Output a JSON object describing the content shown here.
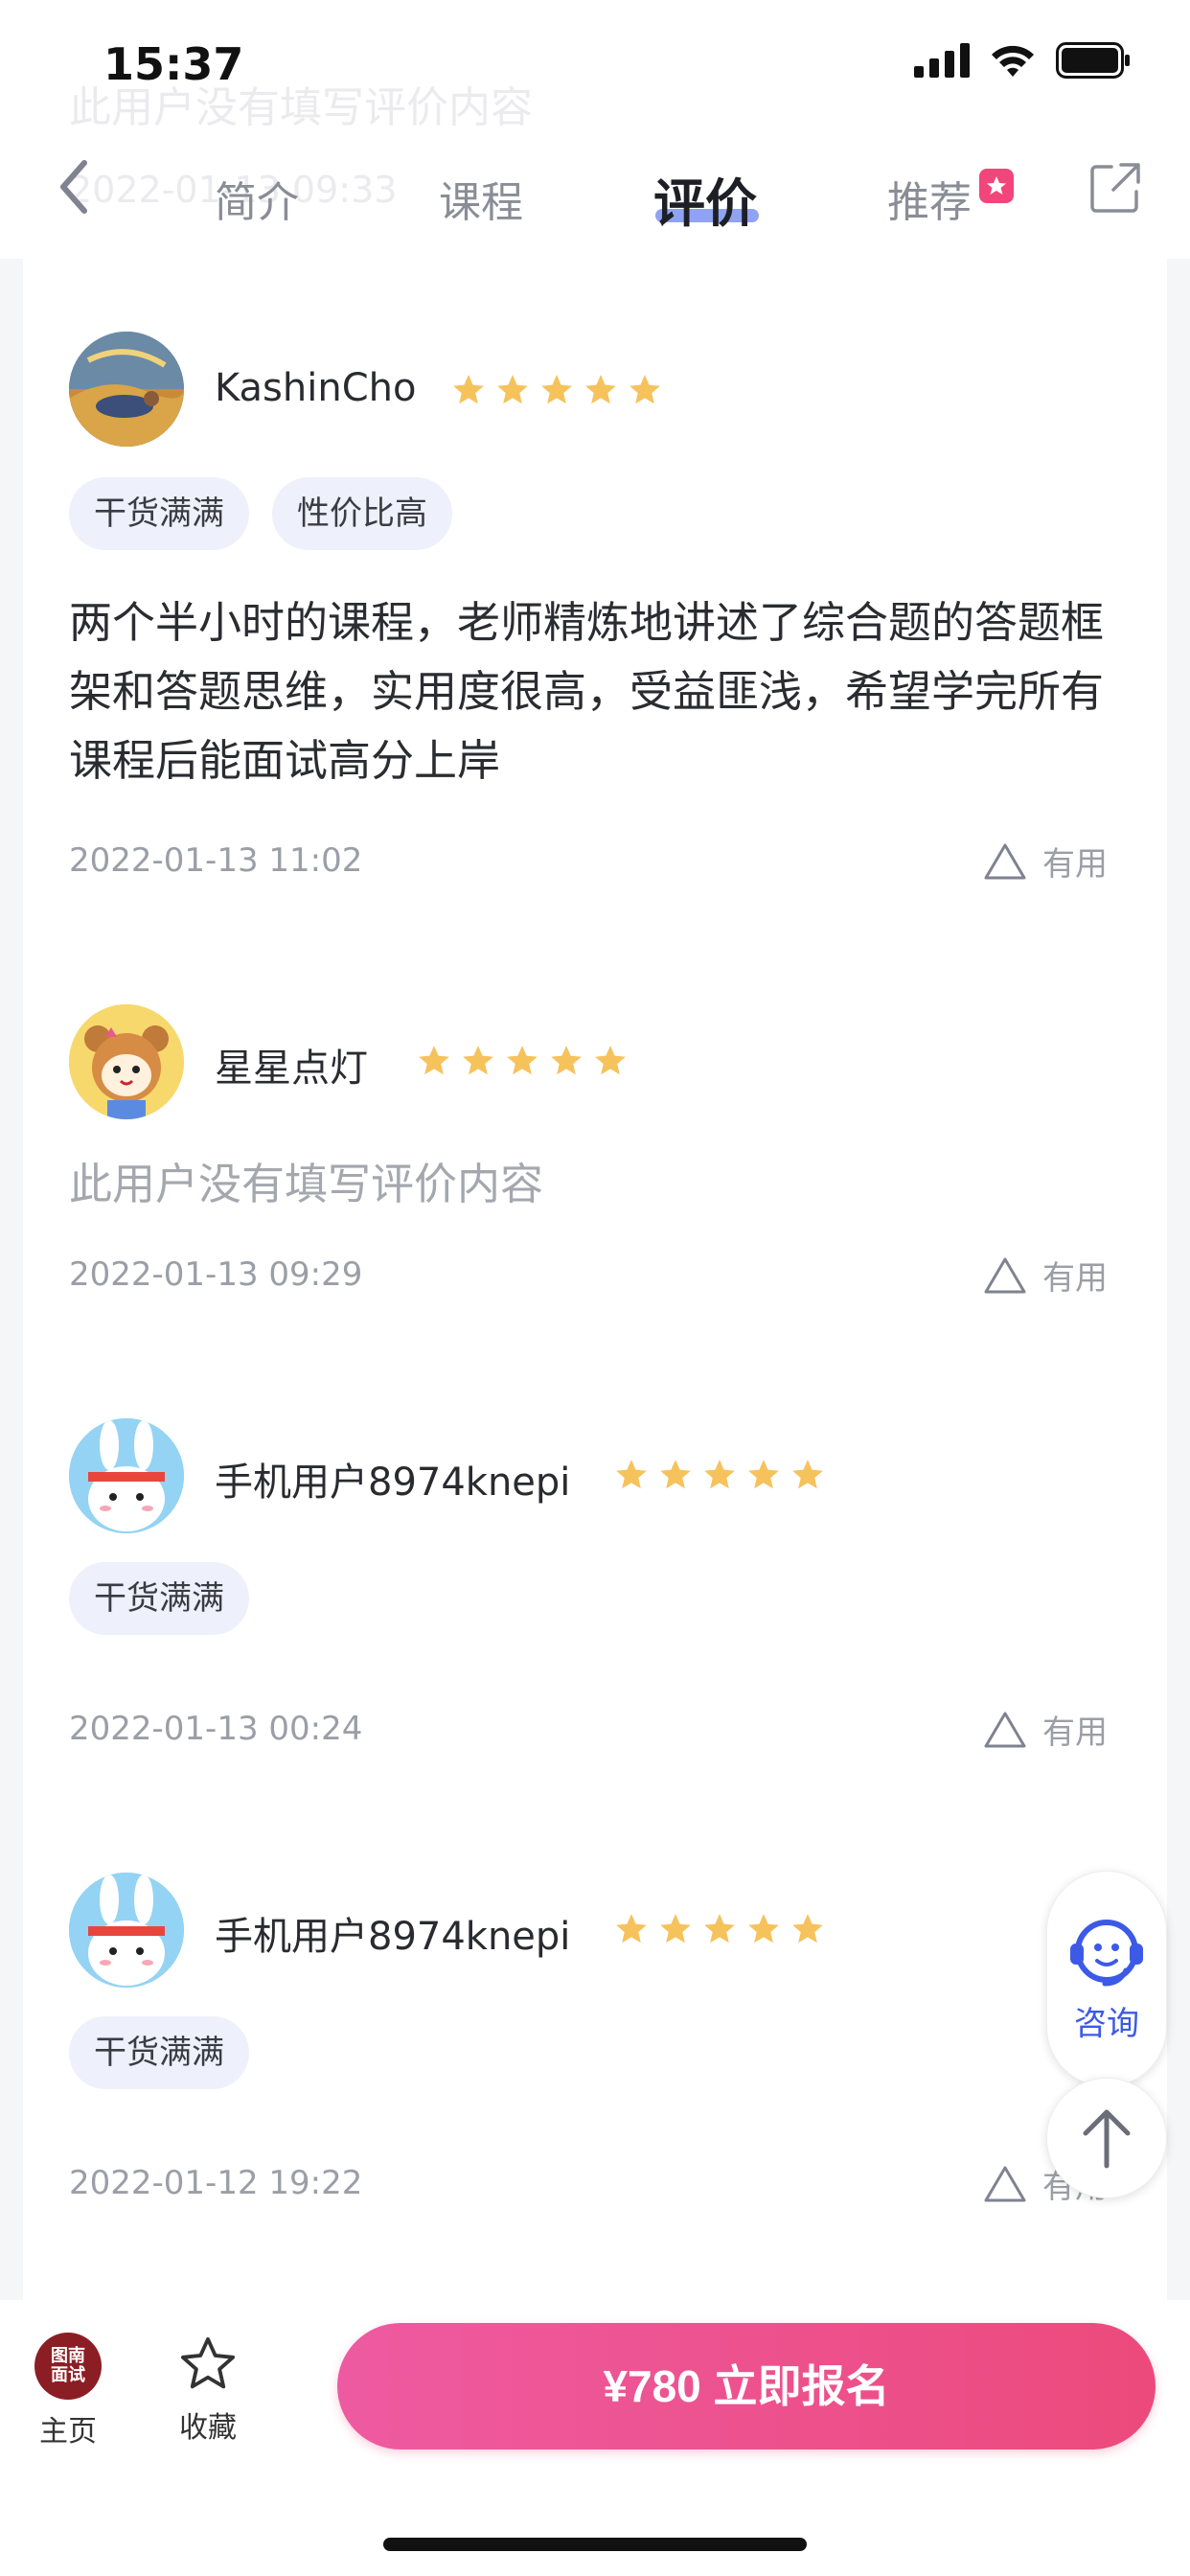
{
  "status_bar": {
    "time": "15:37"
  },
  "ghost_text": {
    "content": "此用户没有填写评价内容",
    "date": "2022-01-13 09:33"
  },
  "nav": {
    "tabs": [
      {
        "label": "简介"
      },
      {
        "label": "课程"
      },
      {
        "label": "评价"
      },
      {
        "label": "推荐"
      }
    ],
    "active_tab": "评价"
  },
  "reviews": [
    {
      "name": "KashinCho",
      "rating": 5,
      "tags": [
        "干货满满",
        "性价比高"
      ],
      "content": "两个半小时的课程，老师精炼地讲述了综合题的答题框架和答题思维，实用度很高，受益匪浅，希望学完所有课程后能面试高分上岸",
      "date": "2022-01-13 11:02",
      "useful_label": "有用"
    },
    {
      "name": "星星点灯",
      "rating": 5,
      "tags": [],
      "content": "此用户没有填写评价内容",
      "date": "2022-01-13 09:29",
      "useful_label": "有用"
    },
    {
      "name": "手机用户8974knepi",
      "rating": 5,
      "tags": [
        "干货满满"
      ],
      "content": "",
      "date": "2022-01-13 00:24",
      "useful_label": "有用"
    },
    {
      "name": "手机用户8974knepi",
      "rating": 5,
      "tags": [
        "干货满满"
      ],
      "content": "",
      "date": "2022-01-12 19:22",
      "useful_label": "有用"
    }
  ],
  "float": {
    "consult_label": "咨询"
  },
  "bottom_bar": {
    "logo_text_line1": "图南",
    "logo_text_line2": "面试",
    "home_label": "主页",
    "favorite_label": "收藏",
    "buy_label": "¥780  立即报名"
  },
  "colors": {
    "star": "#f6c25c",
    "accent_blue": "#3c5ae6",
    "tag_bg": "#eef0fb",
    "buy_gradient_start": "#ee5aa1",
    "buy_gradient_end": "#ec4a7c"
  },
  "icons": {
    "back": "chevron-left-icon",
    "share": "share-icon",
    "useful": "triangle-icon",
    "consult": "customer-service-icon",
    "top": "arrow-up-icon",
    "favorite": "star-outline-icon"
  }
}
